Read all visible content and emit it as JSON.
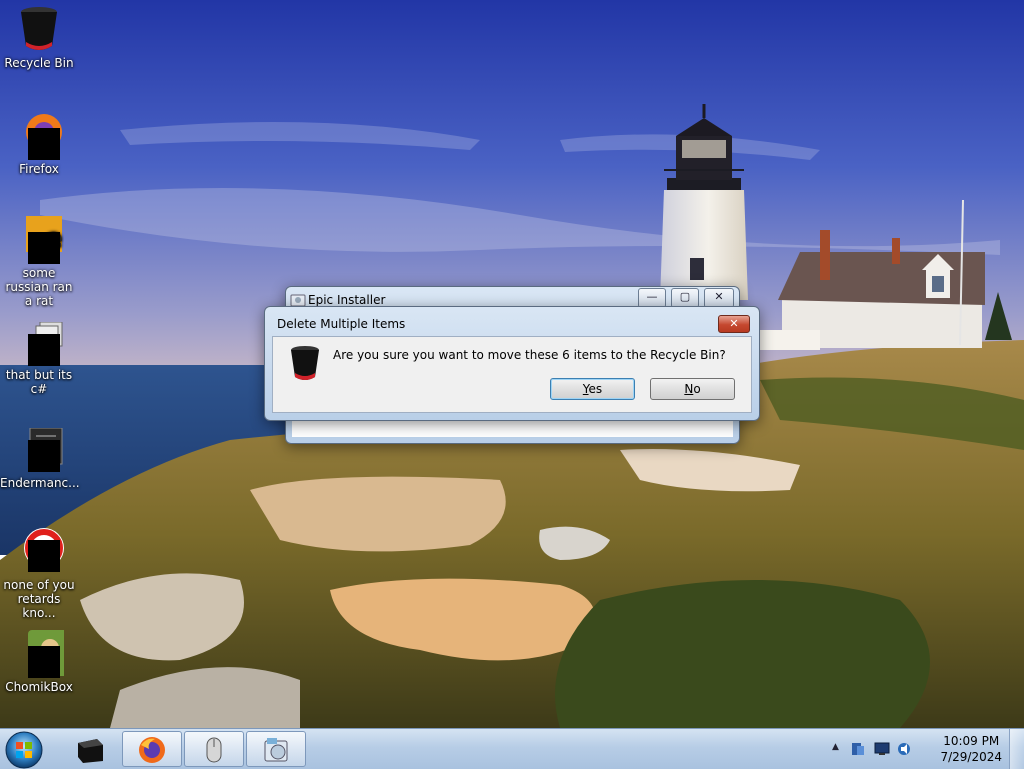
{
  "desktop": {
    "icons": [
      {
        "label": "Recycle Bin"
      },
      {
        "label": "Firefox"
      },
      {
        "label": "some russian ran a rat"
      },
      {
        "label": "that but its c#"
      },
      {
        "label": "Endermanc..."
      },
      {
        "label": "none of you retards kno..."
      },
      {
        "label": "ChomikBox"
      }
    ]
  },
  "background_window": {
    "title": "Epic Installer",
    "minimize": "—",
    "maximize": "▢",
    "close": "✕"
  },
  "dialog": {
    "title": "Delete Multiple Items",
    "message": "Are you sure you want to move these 6 items to the Recycle Bin?",
    "yes_first": "Y",
    "yes_rest": "es",
    "no_first": "N",
    "no_rest": "o",
    "close": "✕"
  },
  "taskbar": {
    "clock_time": "10:09 PM",
    "clock_date": "7/29/2024",
    "tray_arrow": "▲"
  },
  "colors": {
    "sky_top": "#2a3ea8",
    "sky_bottom": "#8a8ec6",
    "sea": "#28508f",
    "grass": "#8d7a2e",
    "taskbar": "#b7cde6"
  }
}
